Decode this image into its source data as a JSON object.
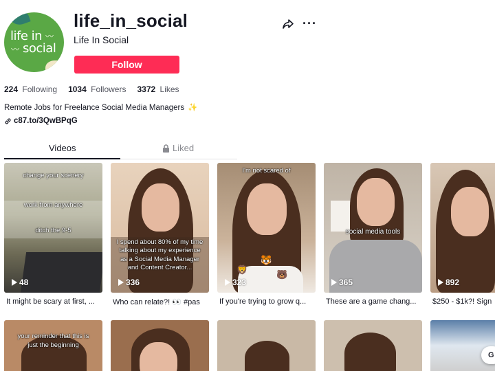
{
  "profile": {
    "username": "life_in_social",
    "nickname": "Life In Social",
    "avatar_text_line1": "life in",
    "avatar_text_line2": "social",
    "follow_label": "Follow",
    "stats": {
      "following_count": "224",
      "following_label": "Following",
      "followers_count": "1034",
      "followers_label": "Followers",
      "likes_count": "3372",
      "likes_label": "Likes"
    },
    "bio": "Remote Jobs for Freelance Social Media Managers",
    "bio_emoji": "✨",
    "link": "c87.to/3QwBPqG"
  },
  "header_icons": [
    "share-icon",
    "more-icon"
  ],
  "tabs": {
    "videos": "Videos",
    "liked": "Liked"
  },
  "videos": [
    {
      "views": "48",
      "overlay": [
        "change your scenery",
        "work from anywhere",
        "ditch the 9-5"
      ],
      "caption": "It might be scary at first, ..."
    },
    {
      "views": "336",
      "overlay": [
        "I spend about 80% of my time talking about my experience as a Social Media Manager and Content Creator..."
      ],
      "caption": "Who can relate?! 👀 #pas"
    },
    {
      "views": "323",
      "overlay": [
        "I'm not scared of"
      ],
      "caption": "If you're trying to grow q..."
    },
    {
      "views": "365",
      "overlay": [
        "social media tools"
      ],
      "caption": "These are a game chang..."
    },
    {
      "views": "892",
      "overlay": [],
      "caption": "$250 - $1k?! Sign"
    }
  ],
  "row2_overlay": [
    "your reminder that this is",
    "just the beginning"
  ],
  "go_button": "G",
  "colors": {
    "follow": "#fe2c55",
    "text": "#161823",
    "muted": "#8a8b91",
    "avatar_bg": "#5aa845"
  }
}
